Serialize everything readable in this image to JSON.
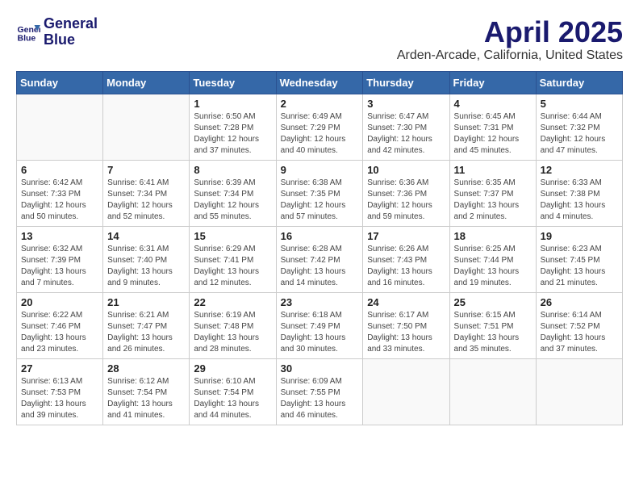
{
  "header": {
    "logo_line1": "General",
    "logo_line2": "Blue",
    "month_title": "April 2025",
    "location": "Arden-Arcade, California, United States"
  },
  "weekdays": [
    "Sunday",
    "Monday",
    "Tuesday",
    "Wednesday",
    "Thursday",
    "Friday",
    "Saturday"
  ],
  "weeks": [
    [
      {
        "day": "",
        "info": ""
      },
      {
        "day": "",
        "info": ""
      },
      {
        "day": "1",
        "info": "Sunrise: 6:50 AM\nSunset: 7:28 PM\nDaylight: 12 hours and 37 minutes."
      },
      {
        "day": "2",
        "info": "Sunrise: 6:49 AM\nSunset: 7:29 PM\nDaylight: 12 hours and 40 minutes."
      },
      {
        "day": "3",
        "info": "Sunrise: 6:47 AM\nSunset: 7:30 PM\nDaylight: 12 hours and 42 minutes."
      },
      {
        "day": "4",
        "info": "Sunrise: 6:45 AM\nSunset: 7:31 PM\nDaylight: 12 hours and 45 minutes."
      },
      {
        "day": "5",
        "info": "Sunrise: 6:44 AM\nSunset: 7:32 PM\nDaylight: 12 hours and 47 minutes."
      }
    ],
    [
      {
        "day": "6",
        "info": "Sunrise: 6:42 AM\nSunset: 7:33 PM\nDaylight: 12 hours and 50 minutes."
      },
      {
        "day": "7",
        "info": "Sunrise: 6:41 AM\nSunset: 7:34 PM\nDaylight: 12 hours and 52 minutes."
      },
      {
        "day": "8",
        "info": "Sunrise: 6:39 AM\nSunset: 7:34 PM\nDaylight: 12 hours and 55 minutes."
      },
      {
        "day": "9",
        "info": "Sunrise: 6:38 AM\nSunset: 7:35 PM\nDaylight: 12 hours and 57 minutes."
      },
      {
        "day": "10",
        "info": "Sunrise: 6:36 AM\nSunset: 7:36 PM\nDaylight: 12 hours and 59 minutes."
      },
      {
        "day": "11",
        "info": "Sunrise: 6:35 AM\nSunset: 7:37 PM\nDaylight: 13 hours and 2 minutes."
      },
      {
        "day": "12",
        "info": "Sunrise: 6:33 AM\nSunset: 7:38 PM\nDaylight: 13 hours and 4 minutes."
      }
    ],
    [
      {
        "day": "13",
        "info": "Sunrise: 6:32 AM\nSunset: 7:39 PM\nDaylight: 13 hours and 7 minutes."
      },
      {
        "day": "14",
        "info": "Sunrise: 6:31 AM\nSunset: 7:40 PM\nDaylight: 13 hours and 9 minutes."
      },
      {
        "day": "15",
        "info": "Sunrise: 6:29 AM\nSunset: 7:41 PM\nDaylight: 13 hours and 12 minutes."
      },
      {
        "day": "16",
        "info": "Sunrise: 6:28 AM\nSunset: 7:42 PM\nDaylight: 13 hours and 14 minutes."
      },
      {
        "day": "17",
        "info": "Sunrise: 6:26 AM\nSunset: 7:43 PM\nDaylight: 13 hours and 16 minutes."
      },
      {
        "day": "18",
        "info": "Sunrise: 6:25 AM\nSunset: 7:44 PM\nDaylight: 13 hours and 19 minutes."
      },
      {
        "day": "19",
        "info": "Sunrise: 6:23 AM\nSunset: 7:45 PM\nDaylight: 13 hours and 21 minutes."
      }
    ],
    [
      {
        "day": "20",
        "info": "Sunrise: 6:22 AM\nSunset: 7:46 PM\nDaylight: 13 hours and 23 minutes."
      },
      {
        "day": "21",
        "info": "Sunrise: 6:21 AM\nSunset: 7:47 PM\nDaylight: 13 hours and 26 minutes."
      },
      {
        "day": "22",
        "info": "Sunrise: 6:19 AM\nSunset: 7:48 PM\nDaylight: 13 hours and 28 minutes."
      },
      {
        "day": "23",
        "info": "Sunrise: 6:18 AM\nSunset: 7:49 PM\nDaylight: 13 hours and 30 minutes."
      },
      {
        "day": "24",
        "info": "Sunrise: 6:17 AM\nSunset: 7:50 PM\nDaylight: 13 hours and 33 minutes."
      },
      {
        "day": "25",
        "info": "Sunrise: 6:15 AM\nSunset: 7:51 PM\nDaylight: 13 hours and 35 minutes."
      },
      {
        "day": "26",
        "info": "Sunrise: 6:14 AM\nSunset: 7:52 PM\nDaylight: 13 hours and 37 minutes."
      }
    ],
    [
      {
        "day": "27",
        "info": "Sunrise: 6:13 AM\nSunset: 7:53 PM\nDaylight: 13 hours and 39 minutes."
      },
      {
        "day": "28",
        "info": "Sunrise: 6:12 AM\nSunset: 7:54 PM\nDaylight: 13 hours and 41 minutes."
      },
      {
        "day": "29",
        "info": "Sunrise: 6:10 AM\nSunset: 7:54 PM\nDaylight: 13 hours and 44 minutes."
      },
      {
        "day": "30",
        "info": "Sunrise: 6:09 AM\nSunset: 7:55 PM\nDaylight: 13 hours and 46 minutes."
      },
      {
        "day": "",
        "info": ""
      },
      {
        "day": "",
        "info": ""
      },
      {
        "day": "",
        "info": ""
      }
    ]
  ]
}
